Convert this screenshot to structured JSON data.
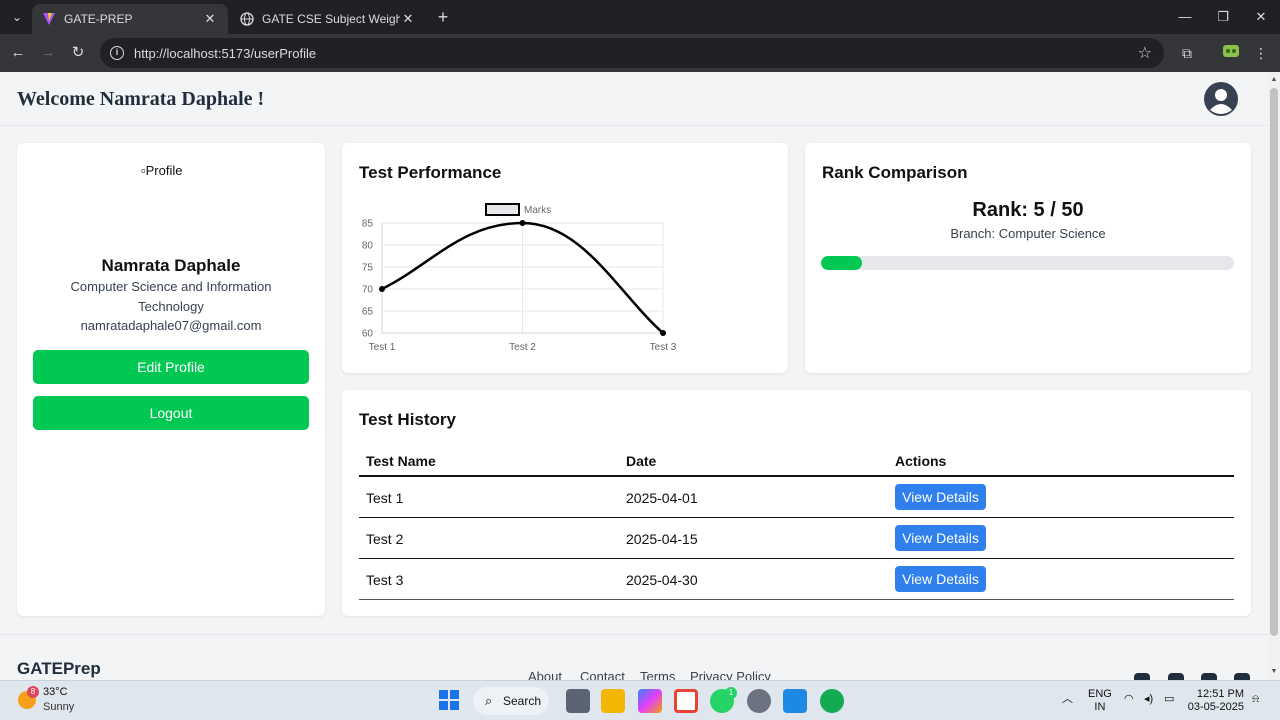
{
  "browser": {
    "tabs": [
      {
        "title": "GATE-PREP",
        "active": true
      },
      {
        "title": "GATE CSE Subject Weightage",
        "active": false
      }
    ],
    "url": "http://localhost:5173/userProfile"
  },
  "header": {
    "welcome": "Welcome Namrata Daphale !"
  },
  "profile": {
    "image_alt": "Profile",
    "name": "Namrata Daphale",
    "branch": "Computer Science and Information Technology",
    "email": "namratadaphale07@gmail.com",
    "edit_label": "Edit Profile",
    "logout_label": "Logout"
  },
  "performance": {
    "title": "Test Performance",
    "chart_data": {
      "type": "line",
      "categories": [
        "Test 1",
        "Test 2",
        "Test 3"
      ],
      "series": [
        {
          "name": "Marks",
          "values": [
            70,
            85,
            60
          ]
        }
      ],
      "ylim": [
        60,
        85
      ],
      "yticks": [
        60,
        65,
        70,
        75,
        80,
        85
      ],
      "legend": "top",
      "grid": true,
      "line_color": "#000000"
    }
  },
  "rank": {
    "title": "Rank Comparison",
    "rank_text": "Rank: 5 / 50",
    "branch_text": "Branch: Computer Science",
    "progress_fraction": 0.1,
    "progress_color": "#00c853"
  },
  "history": {
    "title": "Test History",
    "columns": [
      "Test Name",
      "Date",
      "Actions"
    ],
    "rows": [
      {
        "name": "Test 1",
        "date": "2025-04-01",
        "action": "View Details"
      },
      {
        "name": "Test 2",
        "date": "2025-04-15",
        "action": "View Details"
      },
      {
        "name": "Test 3",
        "date": "2025-04-30",
        "action": "View Details"
      }
    ]
  },
  "footer": {
    "brand": "GATEPrep",
    "links": [
      "About",
      "Contact",
      "Terms",
      "Privacy Policy"
    ]
  },
  "taskbar": {
    "weather_temp": "33°C",
    "weather_cond": "Sunny",
    "weather_badge": "8",
    "search_label": "Search",
    "lang_top": "ENG",
    "lang_bottom": "IN",
    "time": "12:51 PM",
    "date": "03-05-2025",
    "whatsapp_badge": "1"
  },
  "colors": {
    "accent_green": "#00c853",
    "button_blue": "#2f80ed"
  }
}
